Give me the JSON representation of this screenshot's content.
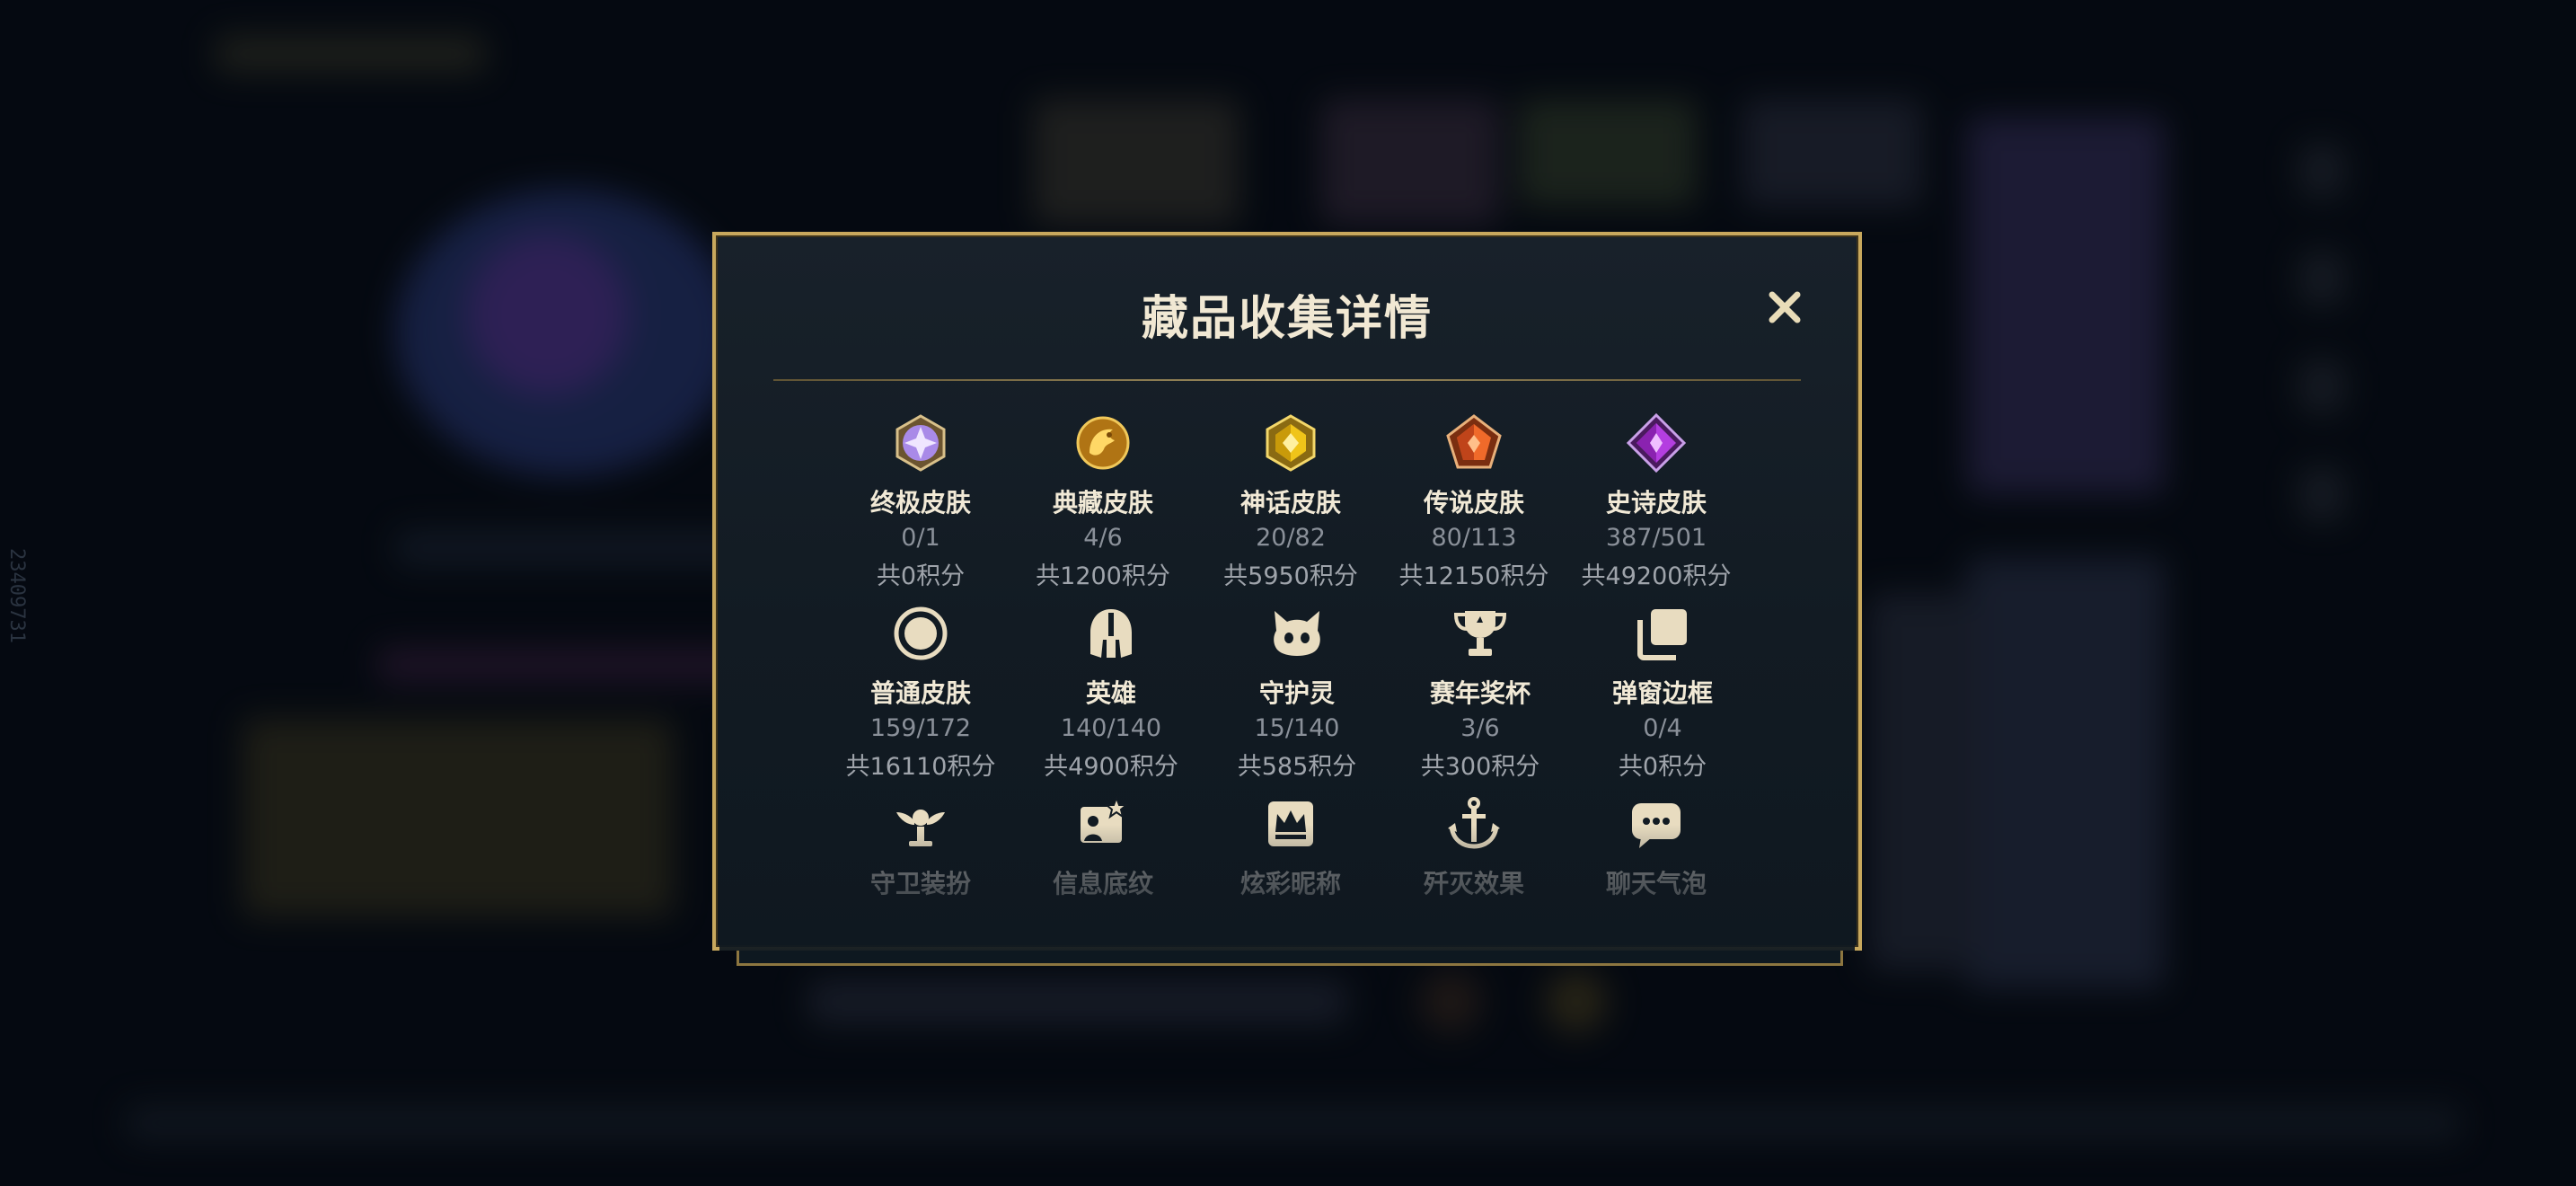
{
  "side_id": "23409731",
  "modal": {
    "title": "藏品收集详情",
    "close_icon": "close-icon"
  },
  "collections": [
    {
      "label": "终极皮肤",
      "count": "0/1",
      "points": "共0积分",
      "icon": "ultimate-skin-icon",
      "color": "#b58cf5"
    },
    {
      "label": "典藏皮肤",
      "count": "4/6",
      "points": "共1200积分",
      "icon": "prestige-skin-icon",
      "color": "#e2a82e"
    },
    {
      "label": "神话皮肤",
      "count": "20/82",
      "points": "共5950积分",
      "icon": "mythic-skin-icon",
      "color": "#f0c419"
    },
    {
      "label": "传说皮肤",
      "count": "80/113",
      "points": "共12150积分",
      "icon": "legendary-skin-icon",
      "color": "#f06a2a"
    },
    {
      "label": "史诗皮肤",
      "count": "387/501",
      "points": "共49200积分",
      "icon": "epic-skin-icon",
      "color": "#b43ee0"
    },
    {
      "label": "普通皮肤",
      "count": "159/172",
      "points": "共16110积分",
      "icon": "standard-skin-icon",
      "color": "#e8dcc0"
    },
    {
      "label": "英雄",
      "count": "140/140",
      "points": "共4900积分",
      "icon": "helmet-icon",
      "color": "#e8dcc0"
    },
    {
      "label": "守护灵",
      "count": "15/140",
      "points": "共585积分",
      "icon": "companion-icon",
      "color": "#e8dcc0"
    },
    {
      "label": "赛年奖杯",
      "count": "3/6",
      "points": "共300积分",
      "icon": "trophy-icon",
      "color": "#e8dcc0"
    },
    {
      "label": "弹窗边框",
      "count": "0/4",
      "points": "共0积分",
      "icon": "frame-icon",
      "color": "#e8dcc0"
    },
    {
      "label": "守卫装扮",
      "icon": "ward-skin-icon",
      "color": "#e8dcc0"
    },
    {
      "label": "信息底纹",
      "icon": "banner-icon",
      "color": "#e8dcc0"
    },
    {
      "label": "炫彩昵称",
      "icon": "crown-icon",
      "color": "#e8dcc0"
    },
    {
      "label": "歼灭效果",
      "icon": "anchor-icon",
      "color": "#e8dcc0"
    },
    {
      "label": "聊天气泡",
      "icon": "chat-bubble-icon",
      "color": "#e8dcc0"
    }
  ]
}
